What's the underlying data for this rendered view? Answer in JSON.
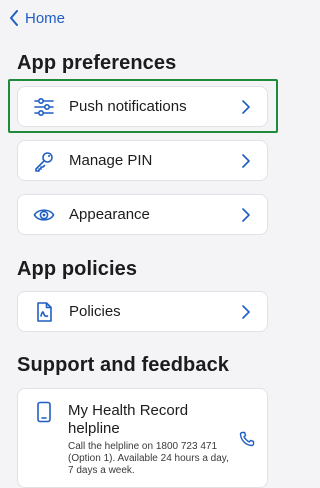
{
  "nav": {
    "back_label": "Home"
  },
  "app_preferences": {
    "title": "App preferences",
    "items": [
      {
        "label": "Push notifications",
        "icon": "sliders-icon"
      },
      {
        "label": "Manage PIN",
        "icon": "key-icon"
      },
      {
        "label": "Appearance",
        "icon": "eye-icon"
      }
    ]
  },
  "app_policies": {
    "title": "App policies",
    "items": [
      {
        "label": "Policies",
        "icon": "document-icon"
      }
    ]
  },
  "support": {
    "title": "Support and feedback",
    "helpline": {
      "title": "My Health Record helpline",
      "description": "Call the helpline on 1800 723 471 (Option 1). Available 24 hours a day, 7 days a week.",
      "icon": "phone-device-icon",
      "action_icon": "phone-call-icon"
    }
  },
  "colors": {
    "accent": "#1f5fc4",
    "highlight": "#1f8a3a",
    "background": "#f4f4f6"
  }
}
